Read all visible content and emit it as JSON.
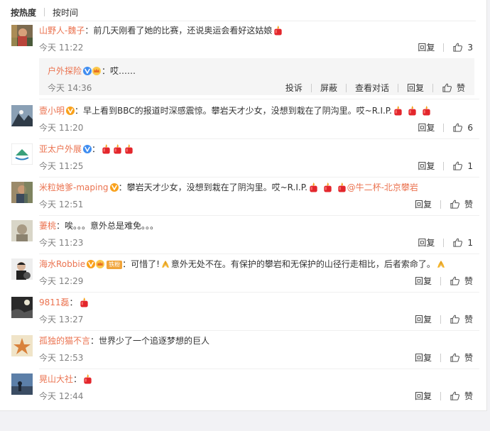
{
  "sort": {
    "hot": "按热度",
    "time": "按时间"
  },
  "labels": {
    "reply": "回复",
    "like": "赞",
    "report": "投诉",
    "block": "屏蔽",
    "view_conv": "查看对话"
  },
  "comments": [
    {
      "name": "山野人-魏子",
      "text": "前几天刚看了她的比赛，还说奥运会看好这姑娘",
      "time": "今天 11:22",
      "likes": "3"
    },
    {
      "name": "壹小明",
      "text": "早上看到BBC的报道时深感震惊。攀岩天才少女，没想到栽在了阴沟里。哎~R.I.P.",
      "time": "今天 11:20",
      "likes": "6"
    },
    {
      "name": "亚太户外展",
      "text": "",
      "time": "今天 11:25",
      "likes": "1"
    },
    {
      "name": "米粒她爹-maping",
      "text": "攀岩天才少女，没想到栽在了阴沟里。哎~R.I.P.",
      "mention": "@牛二杯-北京攀岩",
      "time": "今天 12:51",
      "likes": ""
    },
    {
      "name": "萋桃",
      "text": "唉。。。意外总是难免。。。",
      "time": "今天 11:23",
      "likes": "1"
    },
    {
      "name": "海水Robbie",
      "badge": "铁粉",
      "text_a": "可惜了!",
      "text_b": "意外无处不在。有保护的攀岩和无保护的山径行走相比，后者索命了。",
      "time": "今天 12:29",
      "likes": ""
    },
    {
      "name": "9811磊",
      "text": "",
      "time": "今天 13:27",
      "likes": ""
    },
    {
      "name": "孤独的猫不言",
      "text": "世界少了一个追逐梦想的巨人",
      "time": "今天 12:53",
      "likes": ""
    },
    {
      "name": "晃山大社",
      "text": "",
      "time": "今天 12:44",
      "likes": ""
    }
  ],
  "reply": {
    "name": "户外探险",
    "text": "哎……",
    "time": "今天 14:36"
  },
  "colors": {
    "name": "#eb7350",
    "verified": "#f9a11b",
    "candle": "#e3262c",
    "time": "#808080"
  },
  "icons": [
    "candle-icon",
    "verified-badge-icon",
    "thumb-up-icon",
    "pray-icon",
    "crown-icon"
  ]
}
